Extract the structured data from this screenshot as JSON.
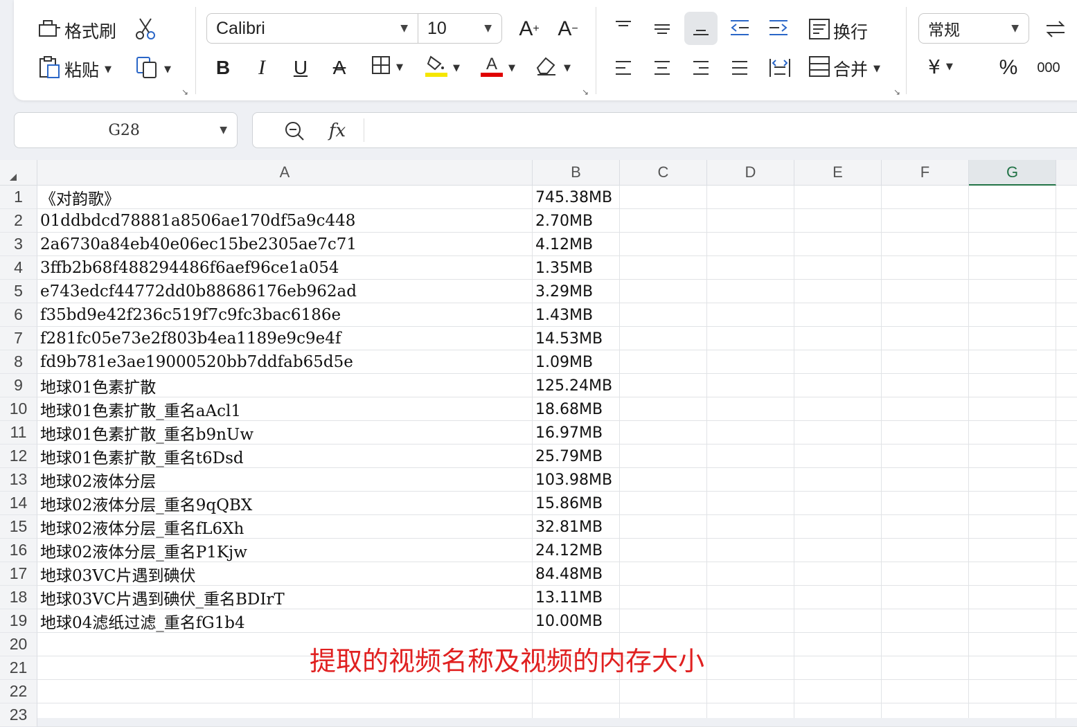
{
  "ribbon": {
    "format_painter": "格式刷",
    "paste": "粘贴",
    "font_name": "Calibri",
    "font_size": "10",
    "wrap_text": "换行",
    "merge": "合并",
    "number_format": "常规"
  },
  "formula_bar": {
    "name_box": "G28",
    "fx_label": "fx",
    "content": ""
  },
  "columns": [
    "A",
    "B",
    "C",
    "D",
    "E",
    "F",
    "G"
  ],
  "active_column": "G",
  "rows": [
    {
      "num": "1",
      "a": "《对韵歌》",
      "b": "745.38MB"
    },
    {
      "num": "2",
      "a": "01ddbdcd78881a8506ae170df5a9c448",
      "b": "2.70MB"
    },
    {
      "num": "3",
      "a": "2a6730a84eb40e06ec15be2305ae7c71",
      "b": "4.12MB"
    },
    {
      "num": "4",
      "a": "3ffb2b68f488294486f6aef96ce1a054",
      "b": "1.35MB"
    },
    {
      "num": "5",
      "a": "e743edcf44772dd0b88686176eb962ad",
      "b": "3.29MB"
    },
    {
      "num": "6",
      "a": "f35bd9e42f236c519f7c9fc3bac6186e",
      "b": "1.43MB"
    },
    {
      "num": "7",
      "a": "f281fc05e73e2f803b4ea1189e9c9e4f",
      "b": "14.53MB"
    },
    {
      "num": "8",
      "a": "fd9b781e3ae19000520bb7ddfab65d5e",
      "b": "1.09MB"
    },
    {
      "num": "9",
      "a": "地球01色素扩散",
      "b": "125.24MB"
    },
    {
      "num": "10",
      "a": "地球01色素扩散_重名aAcl1",
      "b": "18.68MB"
    },
    {
      "num": "11",
      "a": "地球01色素扩散_重名b9nUw",
      "b": "16.97MB"
    },
    {
      "num": "12",
      "a": "地球01色素扩散_重名t6Dsd",
      "b": "25.79MB"
    },
    {
      "num": "13",
      "a": "地球02液体分层",
      "b": "103.98MB"
    },
    {
      "num": "14",
      "a": "地球02液体分层_重名9qQBX",
      "b": "15.86MB"
    },
    {
      "num": "15",
      "a": "地球02液体分层_重名fL6Xh",
      "b": "32.81MB"
    },
    {
      "num": "16",
      "a": "地球02液体分层_重名P1Kjw",
      "b": "24.12MB"
    },
    {
      "num": "17",
      "a": "地球03VC片遇到碘伏",
      "b": "84.48MB"
    },
    {
      "num": "18",
      "a": "地球03VC片遇到碘伏_重名BDIrT",
      "b": "13.11MB"
    },
    {
      "num": "19",
      "a": "地球04滤纸过滤_重名fG1b4",
      "b": "10.00MB"
    },
    {
      "num": "20",
      "a": "",
      "b": ""
    },
    {
      "num": "21",
      "a": "",
      "b": ""
    },
    {
      "num": "22",
      "a": "",
      "b": ""
    },
    {
      "num": "23",
      "a": "",
      "b": ""
    }
  ],
  "annotation": "提取的视频名称及视频的内存大小",
  "colors": {
    "active_col": "#217346",
    "annotation": "#e02020",
    "highlight_yellow": "#f5e600",
    "font_red": "#e00000"
  }
}
